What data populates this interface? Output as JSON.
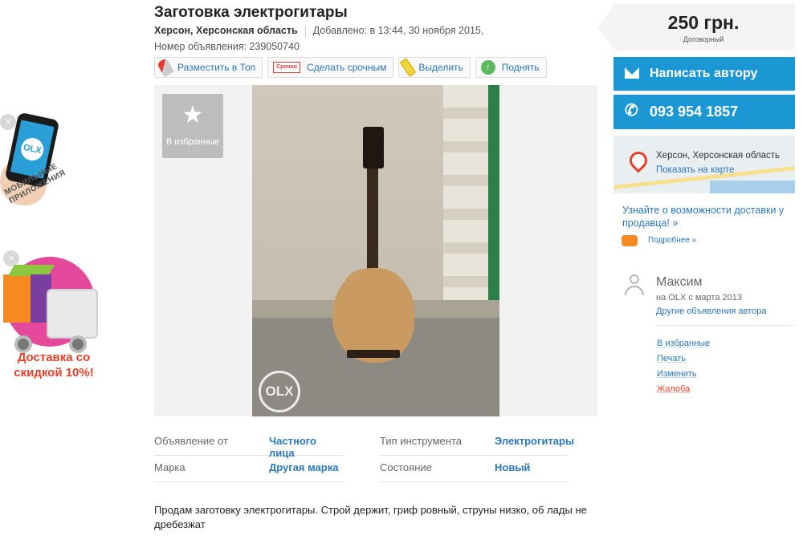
{
  "promo": {
    "app_logo": "OLX",
    "app_label": "мобильные приложения",
    "delivery_text": "Доставка со скидкой 10%!",
    "close_glyph": "×"
  },
  "ad": {
    "title": "Заготовка электрогитары",
    "city": "Херсон, Херсонская область",
    "added": "Добавлено: в 13:44, 30 ноября 2015,",
    "number": "Номер объявления: 239050740",
    "actions": [
      {
        "label": "Разместить в Топ",
        "icon": "rocket-icon"
      },
      {
        "label": "Сделать срочным",
        "icon": "urgent-stamp-icon",
        "stamp": "Срочно"
      },
      {
        "label": "Выделить",
        "icon": "marker-icon"
      },
      {
        "label": "Поднять",
        "icon": "arrow-up-icon"
      }
    ],
    "favorite_tile": "В избранные",
    "photo_watermark": "OLX",
    "params": [
      {
        "key": "Объявление от",
        "value": "Частного лица"
      },
      {
        "key": "Тип инструмента",
        "value": "Электрогитары"
      },
      {
        "key": "Марка",
        "value": "Другая марка"
      },
      {
        "key": "Состояние",
        "value": "Новый"
      }
    ],
    "description": "Продам заготовку электрогитары. Строй держит, гриф ровный, струны низко, об лады не дребезжат"
  },
  "sidebar": {
    "price": "250 грн.",
    "price_note": "Договорный",
    "write_author": "Написать автору",
    "phone": "093 954 1857",
    "map_city": "Херсон, Херсонская область",
    "map_link": "Показать на карте",
    "delivery_link": "Узнайте о возможности доставки у продавца! »",
    "more_link": "Подробнее »",
    "user_name": "Максим",
    "user_since": "на OLX с марта 2013",
    "user_other": "Другие объявления автора",
    "links": [
      "В избранные",
      "Печать",
      "Изменить",
      "Жалоба"
    ]
  },
  "colors": {
    "accent": "#1b97d4",
    "link": "#2b77b9",
    "danger": "#e64027"
  }
}
